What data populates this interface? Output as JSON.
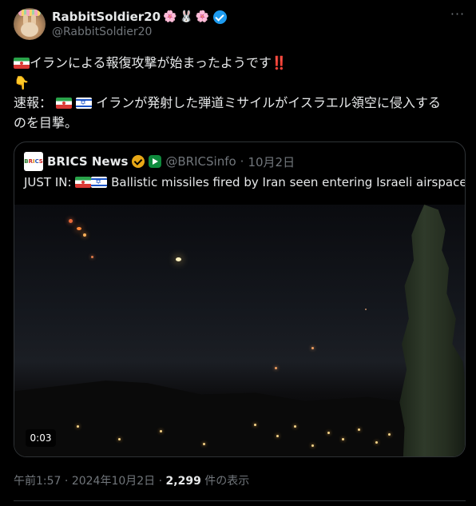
{
  "author": {
    "display_name": "RabbitSoldier20",
    "name_emojis": [
      "🌸",
      "🐰",
      "🌸"
    ],
    "handle": "@RabbitSoldier20",
    "verified": true
  },
  "more_button": "···",
  "post": {
    "line1_text": "イランによる報復攻撃が始まったようです",
    "line1_bangs": "‼️",
    "line2_emoji": "👇",
    "line3_prefix": "速報：",
    "line3_text": "イランが発射した弾道ミサイルがイスラエル領空に侵入する",
    "line4_text": "のを目撃。"
  },
  "quote": {
    "avatar_text": [
      "B",
      "R",
      "I",
      "C",
      "S"
    ],
    "name": "BRICS News",
    "handle": "@BRICSinfo",
    "separator": "·",
    "date": "10月2日",
    "text_prefix": "JUST IN:",
    "text_body": "Ballistic missiles fired by Iran seen entering Israeli airspace.",
    "video_duration": "0:03"
  },
  "meta": {
    "time": "午前1:57",
    "separator": "·",
    "date": "2024年10月2日",
    "views_count": "2,299",
    "views_label": "件の表示"
  },
  "colors": {
    "background": "#000000",
    "text": "#e7e9ea",
    "muted": "#71767b",
    "border": "#2f3336",
    "verified_blue": "#1d9bf0",
    "verified_gold": "#e8a817"
  }
}
